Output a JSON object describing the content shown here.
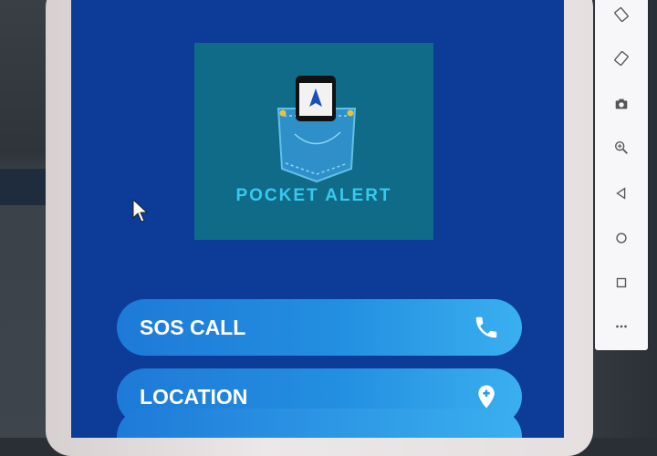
{
  "app": {
    "logo_text": "POCKET ALERT",
    "buttons": [
      {
        "label": "SOS CALL",
        "icon": "phone-icon"
      },
      {
        "label": "LOCATION",
        "icon": "location-pin-icon"
      }
    ]
  },
  "emulator_toolbar": {
    "items": [
      "rotate-left-icon",
      "rotate-right-icon",
      "camera-icon",
      "zoom-icon",
      "back-icon",
      "home-icon",
      "overview-icon",
      "more-icon"
    ]
  },
  "colors": {
    "screen_bg": "#0c3c98",
    "logo_bg": "#0f6b88",
    "button_gradient_start": "#1e7ad8",
    "button_gradient_end": "#3aaff0"
  }
}
